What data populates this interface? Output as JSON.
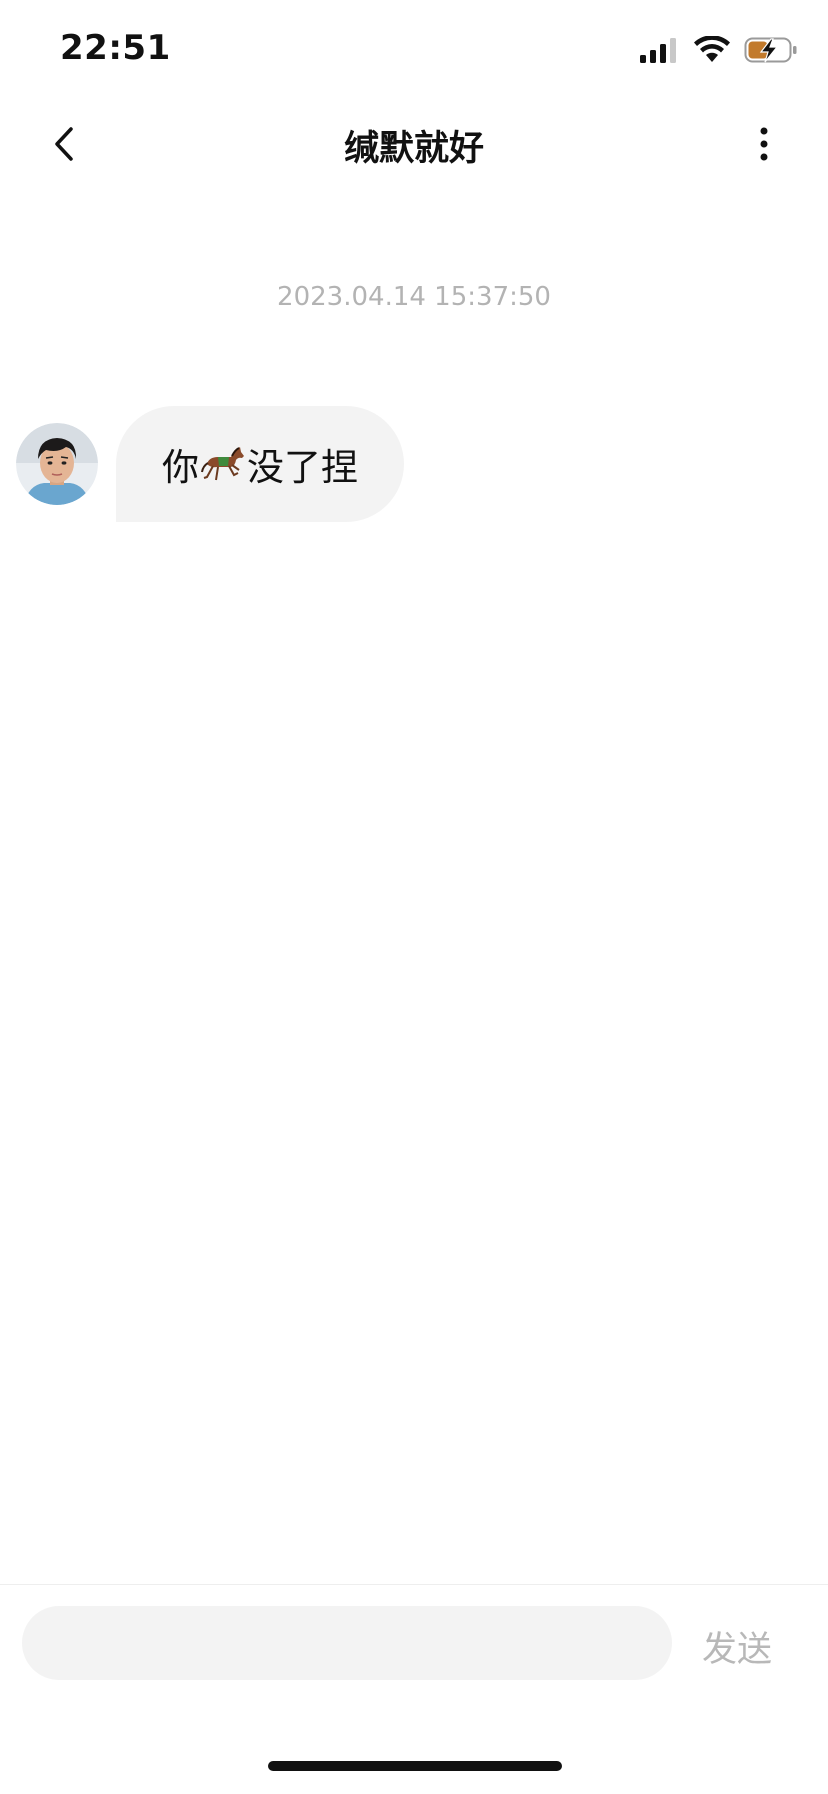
{
  "status_bar": {
    "time": "22:51",
    "icons": [
      "cellular-signal-icon",
      "wifi-icon",
      "battery-charging-icon"
    ],
    "battery_color": "#c27a2c"
  },
  "nav": {
    "back_icon": "chevron-left-icon",
    "title": "缄默就好",
    "more_icon": "more-vertical-icon"
  },
  "chat": {
    "timestamp": "2023.04.14 15:37:50",
    "messages": [
      {
        "sender": "other",
        "avatar": "avatar",
        "text_before": "你",
        "emoji": "horse-racing-emoji",
        "text_after": "没了捏"
      }
    ]
  },
  "composer": {
    "input_value": "",
    "placeholder": "",
    "send_label": "发送"
  },
  "colors": {
    "bubble_bg": "#f3f3f3",
    "timestamp": "#b3b3b3",
    "send_disabled": "#b8b8b8"
  }
}
